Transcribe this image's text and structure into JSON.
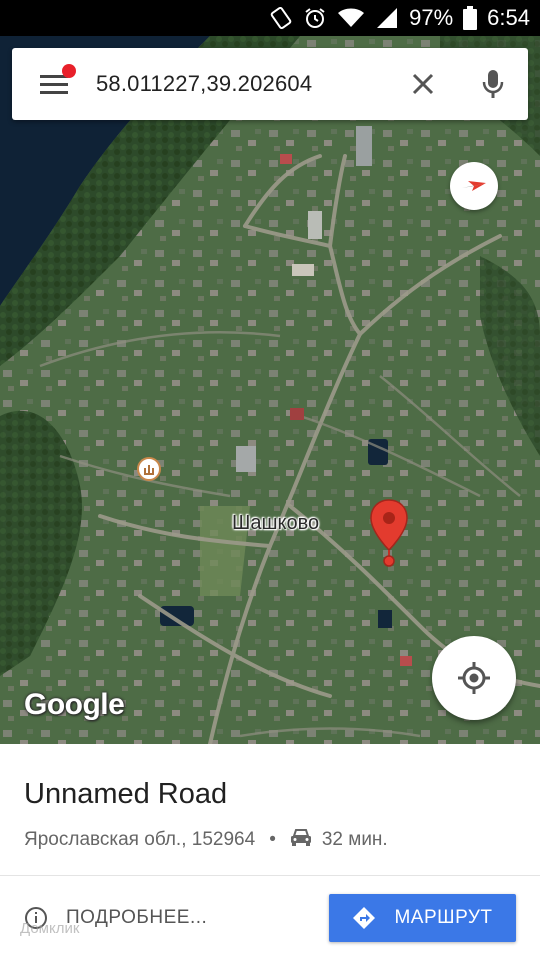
{
  "status_bar": {
    "battery": "97%",
    "time": "6:54",
    "icons": [
      "rotate-lock-icon",
      "alarm-icon",
      "wifi-icon",
      "signal-icon",
      "battery-icon"
    ]
  },
  "search": {
    "value": "58.011227,39.202604",
    "menu_icon": "menu-icon",
    "clear_icon": "close-icon",
    "voice_icon": "mic-icon"
  },
  "map": {
    "place_label": "Шашково",
    "logo": "Google",
    "compass_icon": "compass-icon",
    "my_location_icon": "my-location-icon",
    "pin_icon": "map-pin-icon",
    "poi_icon": "poi-icon"
  },
  "place": {
    "title": "Unnamed Road",
    "address": "Ярославская обл., 152964",
    "separator": "•",
    "drive_time": "32 мин.",
    "car_icon": "car-icon"
  },
  "actions": {
    "details_label": "ПОДРОБНЕЕ...",
    "details_icon": "info-icon",
    "route_label": "МАРШРУТ",
    "route_icon": "directions-icon"
  },
  "watermark": "Домклик",
  "colors": {
    "accent": "#3b78e7",
    "pin": "#e33b2e",
    "notification_dot": "#e8202a"
  }
}
